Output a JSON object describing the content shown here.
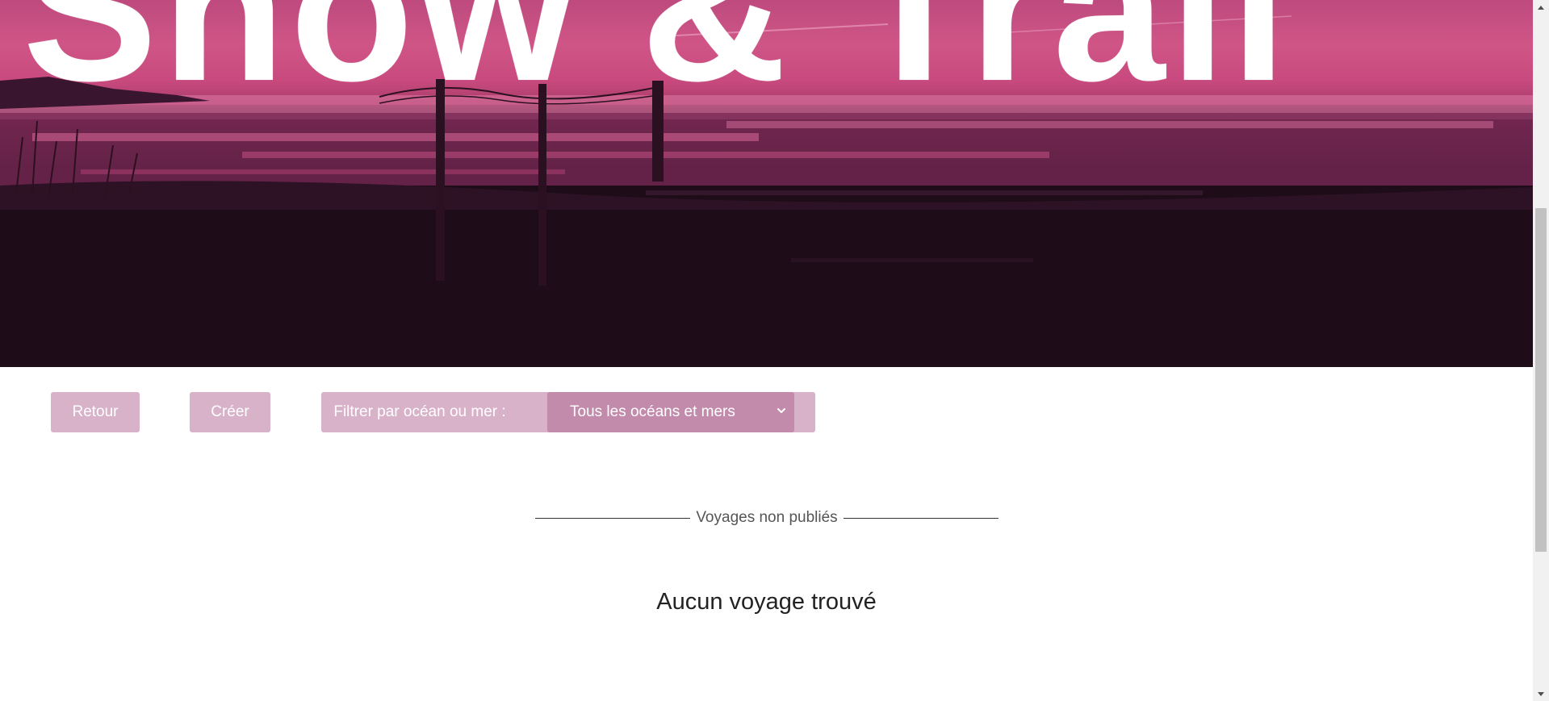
{
  "hero": {
    "title": "Show & Trail",
    "image_icon": "landscape-image"
  },
  "toolbar": {
    "back_label": "Retour",
    "create_label": "Créer",
    "filter_label": "Filtrer par océan ou mer :",
    "filter_selected": "Tous les océans et mers",
    "filter_icon": "chevron-down-icon"
  },
  "section": {
    "title": "Voyages non publiés"
  },
  "results": {
    "empty_message": "Aucun voyage trouvé"
  },
  "scrollbar": {
    "up_icon": "arrow-up-icon",
    "down_icon": "arrow-down-icon"
  },
  "colors": {
    "button_bg": "#d8b2c8",
    "select_bg": "#c28aab",
    "hero_pink": "#d8638f",
    "hero_dark": "#1f0d1a"
  }
}
